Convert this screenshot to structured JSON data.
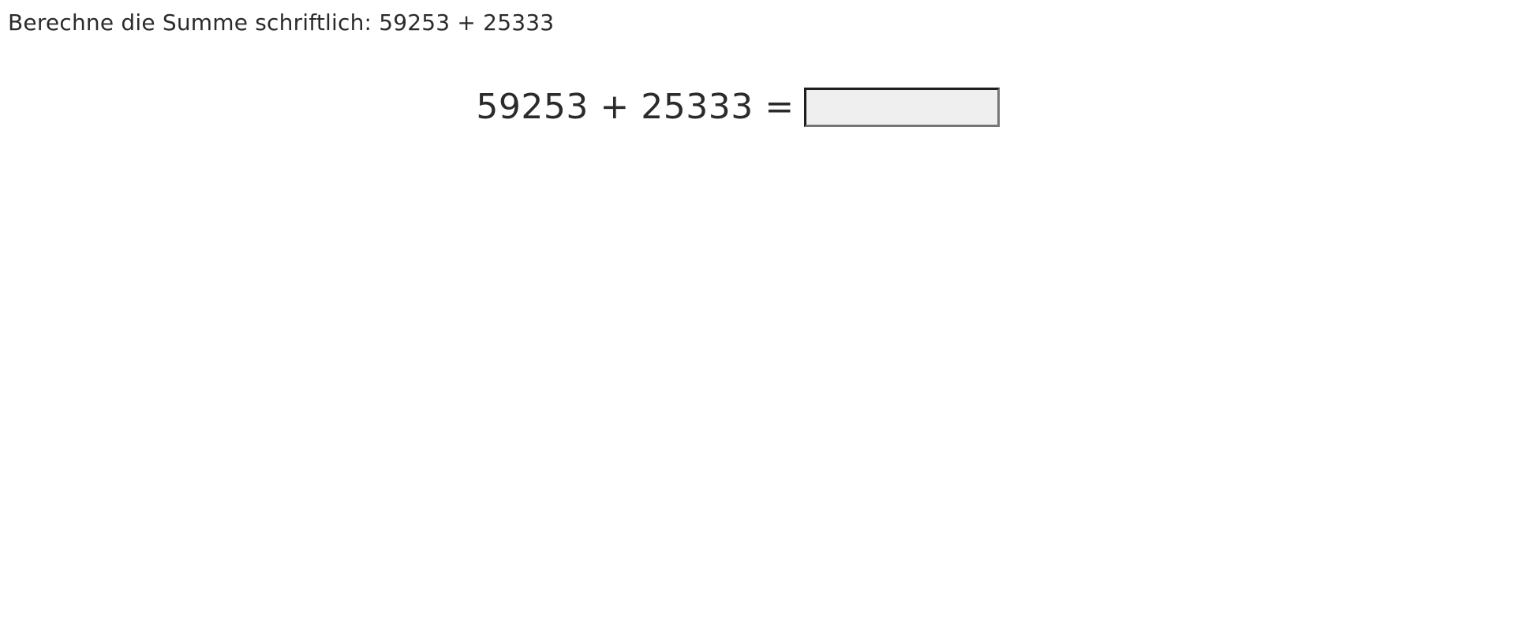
{
  "instruction": "Berechne die Summe schriftlich: 59253 + 25333",
  "equation": {
    "text": "59253 + 25333 =",
    "answer_value": "",
    "answer_placeholder": ""
  },
  "colors": {
    "text": "#2b2b2b",
    "input_background": "#efefef",
    "input_border_dark": "#1e1e1e",
    "input_border_light": "#767676"
  }
}
